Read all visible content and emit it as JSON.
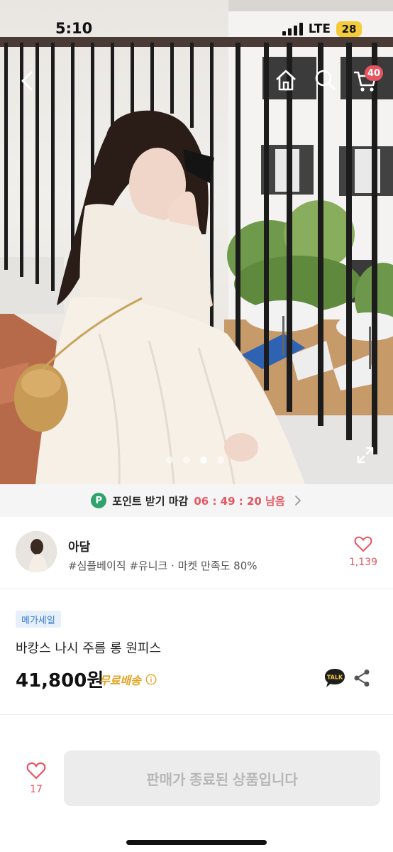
{
  "status_bar": {
    "time": "5:10",
    "network": "LTE",
    "battery": "28"
  },
  "header": {
    "cart_count": "40"
  },
  "gallery": {
    "image_count": 4,
    "active_index": 2
  },
  "points_banner": {
    "badge": "P",
    "label": "포인트 받기 마감",
    "timer": "06 : 49 : 20 남음"
  },
  "shop": {
    "name": "아담",
    "tags": "#심플베이직 #유니크 · 마켓 만족도 80%",
    "like_count": "1,139"
  },
  "product": {
    "sale_badge": "메가세일",
    "title": "바캉스 나시 주름 롱 원피스",
    "price": "41,800원",
    "shipping": "무료배송",
    "talk_label": "TALK"
  },
  "bottom_bar": {
    "like_count": "17",
    "button_label": "판매가 종료된 상품입니다"
  },
  "colors": {
    "accent": "#e8545f",
    "points_green": "#2fa36b",
    "shipping": "#e6a224",
    "sale_badge_text": "#3a7ccf"
  }
}
